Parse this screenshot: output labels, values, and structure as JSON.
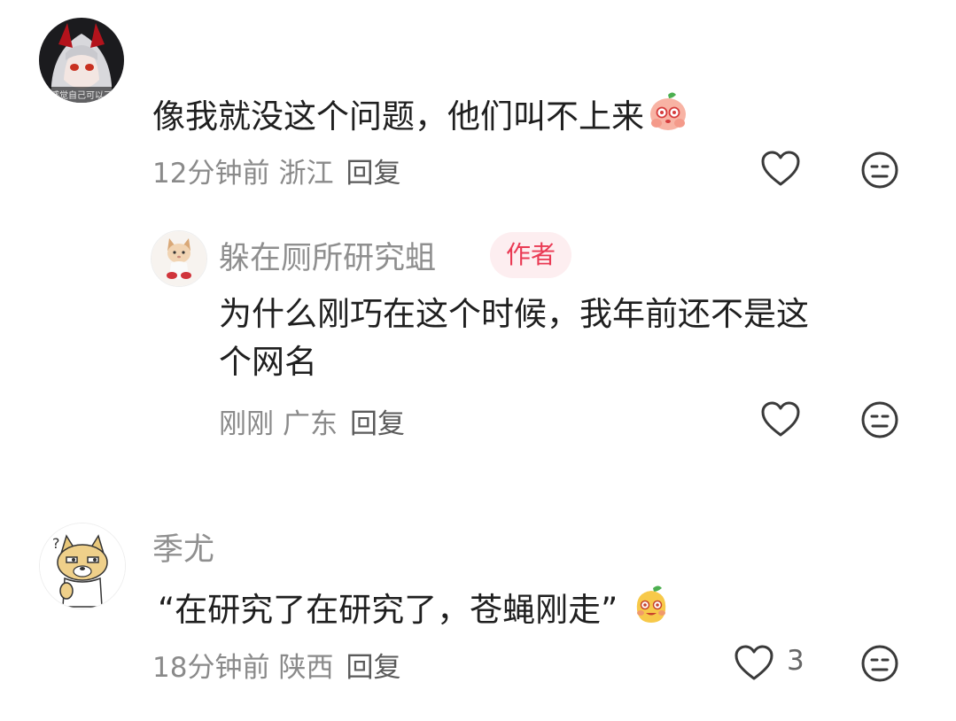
{
  "comments": [
    {
      "text": "像我就没这个问题，他们叫不上来",
      "emoji": "peach-face-emoji",
      "time": "12分钟前",
      "location": "浙江",
      "reply_label": "回复",
      "avatar_caption": "感觉自己可以了"
    },
    {
      "username": "躲在厕所研究蛆",
      "badge": "作者",
      "text_line1": "为什么刚巧在这个时候，我年前还不是这",
      "text_line2": "个网名",
      "time": "刚刚",
      "location": "广东",
      "reply_label": "回复"
    },
    {
      "username": "季尤",
      "text": "“在研究了在研究了，苍蝇刚走”",
      "emoji": "mango-face-emoji",
      "time": "18分钟前",
      "location": "陕西",
      "reply_label": "回复",
      "like_count": "3"
    }
  ],
  "icons": {
    "like": "heart-outline-icon",
    "dislike": "meh-face-icon"
  },
  "colors": {
    "badge_text": "#ea3a54",
    "badge_bg": "#fdeef0",
    "meta": "#8a8a8a"
  }
}
